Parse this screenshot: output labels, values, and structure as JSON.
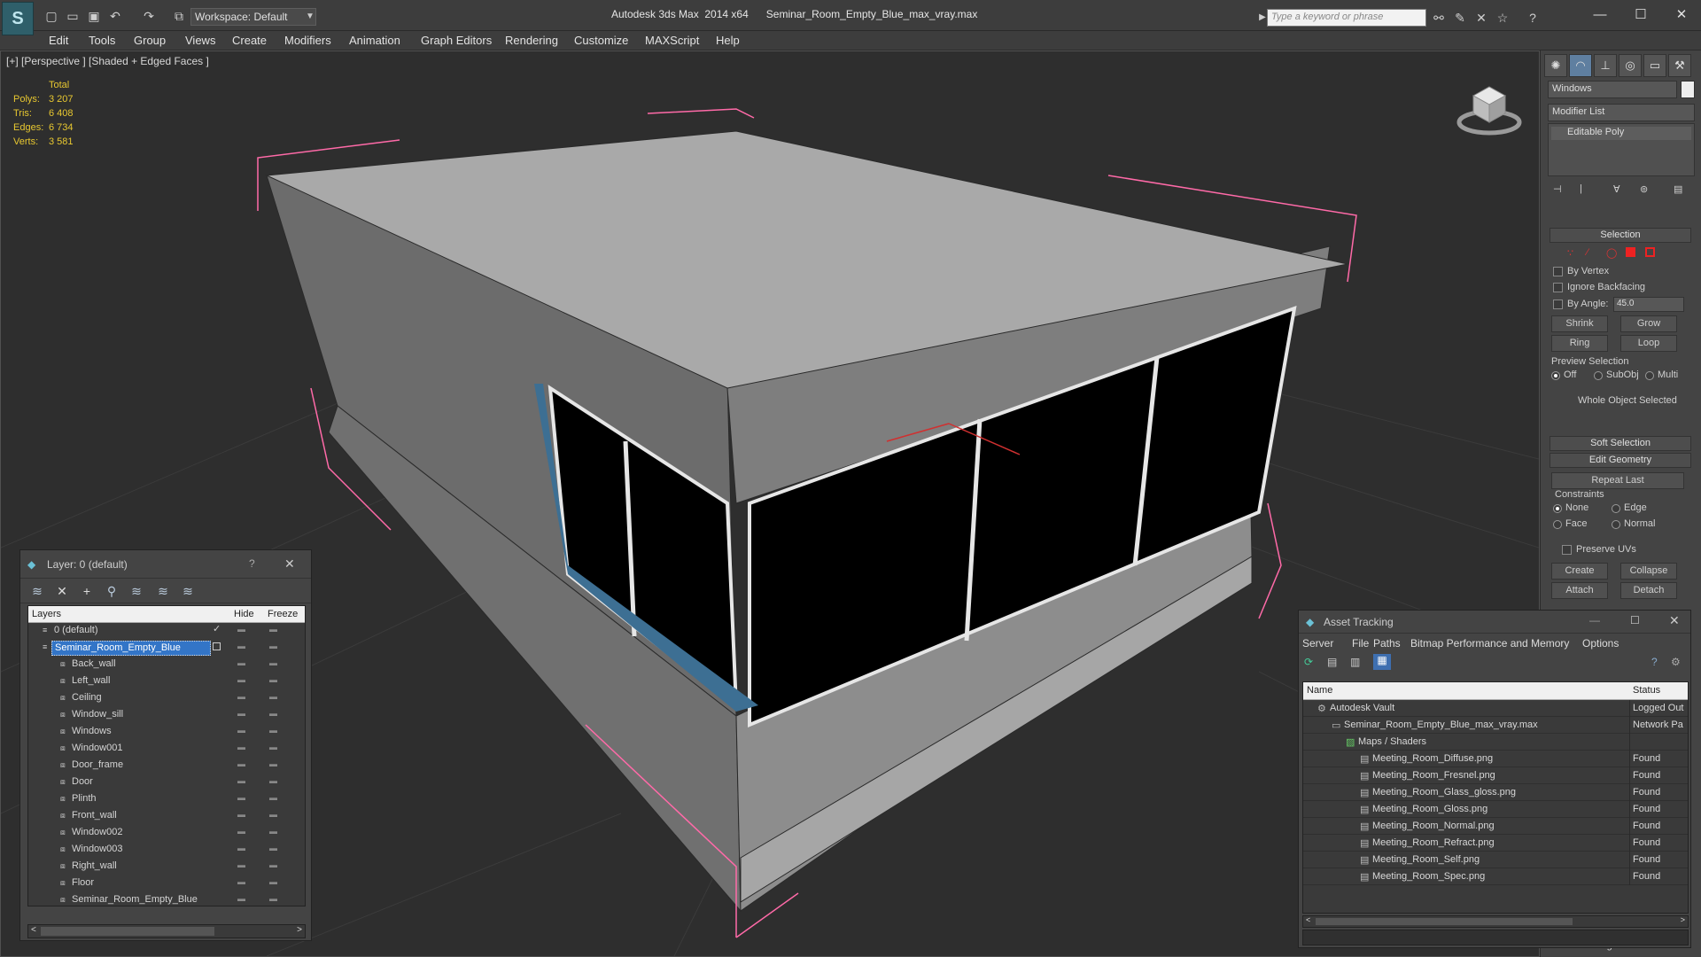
{
  "titlebar": {
    "logo": "S",
    "workspace": "Workspace: Default",
    "app_name": "Autodesk 3ds Max  2014 x64",
    "file_name": "Seminar_Room_Empty_Blue_max_vray.max",
    "search_placeholder": "Type a keyword or phrase",
    "minimize": "—",
    "maximize": "☐",
    "close": "✕"
  },
  "menu": [
    "Edit",
    "Tools",
    "Group",
    "Views",
    "Create",
    "Modifiers",
    "Animation",
    "Graph Editors",
    "Rendering",
    "Customize",
    "MAXScript",
    "Help"
  ],
  "viewport": {
    "label": "[+] [Perspective ] [Shaded + Edged Faces ]",
    "stats_header": "Total",
    "stats": [
      {
        "k": "Polys:",
        "v": "3 207"
      },
      {
        "k": "Tris:",
        "v": "6 408"
      },
      {
        "k": "Edges:",
        "v": "6 734"
      },
      {
        "k": "Verts:",
        "v": "3 581"
      }
    ]
  },
  "command_panel": {
    "object_name": "Windows",
    "modifier_list": "Modifier List",
    "stack_item": "Editable Poly",
    "selection_rollout": "Selection",
    "by_vertex": "By Vertex",
    "ignore_backfacing": "Ignore Backfacing",
    "by_angle": "By Angle:",
    "angle_value": "45.0",
    "shrink": "Shrink",
    "grow": "Grow",
    "ring": "Ring",
    "loop": "Loop",
    "preview_selection": "Preview Selection",
    "off": "Off",
    "subobj": "SubObj",
    "multi": "Multi",
    "whole_object": "Whole Object Selected",
    "soft_selection": "Soft Selection",
    "edit_geometry": "Edit Geometry",
    "repeat_last": "Repeat Last",
    "constraints": "Constraints",
    "none": "None",
    "edge": "Edge",
    "face": "Face",
    "normal": "Normal",
    "preserve_uvs": "Preserve UVs",
    "create": "Create",
    "collapse": "Collapse",
    "attach": "Attach",
    "detach": "Detach",
    "show_cage": "Show Cage......"
  },
  "layer_window": {
    "title": "Layer: 0 (default)",
    "help": "?",
    "close": "✕",
    "columns": {
      "layers": "Layers",
      "hide": "Hide",
      "freeze": "Freeze"
    },
    "rows": [
      {
        "name": "0 (default)",
        "level": 0
      },
      {
        "name": "Seminar_Room_Empty_Blue",
        "level": 0
      },
      {
        "name": "Back_wall",
        "level": 1
      },
      {
        "name": "Left_wall",
        "level": 1
      },
      {
        "name": "Ceiling",
        "level": 1
      },
      {
        "name": "Window_sill",
        "level": 1
      },
      {
        "name": "Windows",
        "level": 1
      },
      {
        "name": "Window001",
        "level": 1
      },
      {
        "name": "Door_frame",
        "level": 1
      },
      {
        "name": "Door",
        "level": 1
      },
      {
        "name": "Plinth",
        "level": 1
      },
      {
        "name": "Front_wall",
        "level": 1
      },
      {
        "name": "Window002",
        "level": 1
      },
      {
        "name": "Window003",
        "level": 1
      },
      {
        "name": "Right_wall",
        "level": 1
      },
      {
        "name": "Floor",
        "level": 1
      },
      {
        "name": "Seminar_Room_Empty_Blue",
        "level": 1
      }
    ]
  },
  "asset_window": {
    "title": "Asset Tracking",
    "menu": [
      "Server",
      "File",
      "Paths",
      "Bitmap Performance and Memory",
      "Options"
    ],
    "columns": {
      "name": "Name",
      "status": "Status"
    },
    "rows": [
      {
        "name": "Autodesk Vault",
        "status": "Logged Out",
        "level": 1
      },
      {
        "name": "Seminar_Room_Empty_Blue_max_vray.max",
        "status": "Network Pa",
        "level": 2
      },
      {
        "name": "Maps / Shaders",
        "status": "",
        "level": 3
      },
      {
        "name": "Meeting_Room_Diffuse.png",
        "status": "Found",
        "level": 4
      },
      {
        "name": "Meeting_Room_Fresnel.png",
        "status": "Found",
        "level": 4
      },
      {
        "name": "Meeting_Room_Glass_gloss.png",
        "status": "Found",
        "level": 4
      },
      {
        "name": "Meeting_Room_Gloss.png",
        "status": "Found",
        "level": 4
      },
      {
        "name": "Meeting_Room_Normal.png",
        "status": "Found",
        "level": 4
      },
      {
        "name": "Meeting_Room_Refract.png",
        "status": "Found",
        "level": 4
      },
      {
        "name": "Meeting_Room_Self.png",
        "status": "Found",
        "level": 4
      },
      {
        "name": "Meeting_Room_Spec.png",
        "status": "Found",
        "level": 4
      }
    ]
  },
  "colors": {
    "stats": "#e8c830",
    "selection_blue": "#3375c7",
    "bbox_pink": "#ff6aa8",
    "glass": "#000000",
    "window_frame": "#e8e8e8",
    "sill_blue": "#3d6f93"
  }
}
